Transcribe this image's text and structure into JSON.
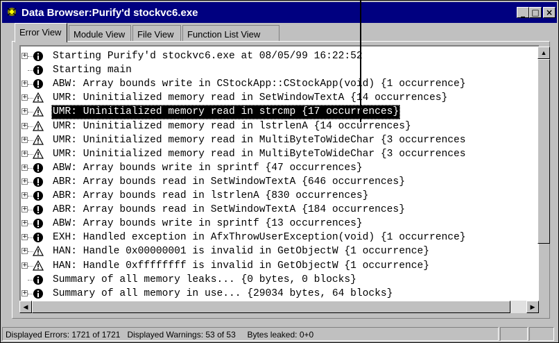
{
  "window": {
    "title": "Data Browser:Purify'd stockvc6.exe",
    "controls": {
      "minimize": "_",
      "maximize": "□",
      "close": "×"
    }
  },
  "tabs": [
    {
      "label": "Error View",
      "active": true
    },
    {
      "label": "Module View",
      "active": false
    },
    {
      "label": "File View",
      "active": false
    },
    {
      "label": "Function List View",
      "active": false
    }
  ],
  "rows": [
    {
      "text": "Starting Purify'd stockvc6.exe at 08/05/99 16:22:52",
      "icon": "info-icon",
      "expandable": true
    },
    {
      "text": "Starting main",
      "icon": "info-icon",
      "expandable": false
    },
    {
      "text": "ABW: Array bounds write in CStockApp::CStockApp(void) {1 occurrence}",
      "icon": "error-icon",
      "expandable": true
    },
    {
      "text": "UMR: Uninitialized memory read in SetWindowTextA {14 occurrences}",
      "icon": "warning-icon",
      "expandable": true
    },
    {
      "text": "UMR: Uninitialized memory read in strcmp {17 occurrences}",
      "icon": "warning-icon",
      "expandable": true,
      "selected": true
    },
    {
      "text": "UMR: Uninitialized memory read in lstrlenA {14 occurrences}",
      "icon": "warning-icon",
      "expandable": true
    },
    {
      "text": "UMR: Uninitialized memory read in MultiByteToWideChar {3 occurrences",
      "icon": "warning-icon",
      "expandable": true
    },
    {
      "text": "UMR: Uninitialized memory read in MultiByteToWideChar {3 occurrences",
      "icon": "warning-icon",
      "expandable": true
    },
    {
      "text": "ABW: Array bounds write in sprintf {47 occurrences}",
      "icon": "error-icon",
      "expandable": true
    },
    {
      "text": "ABR: Array bounds read in SetWindowTextA {646 occurrences}",
      "icon": "error-icon",
      "expandable": true
    },
    {
      "text": "ABR: Array bounds read in lstrlenA {830 occurrences}",
      "icon": "error-icon",
      "expandable": true
    },
    {
      "text": "ABR: Array bounds read in SetWindowTextA {184 occurrences}",
      "icon": "error-icon",
      "expandable": true
    },
    {
      "text": "ABW: Array bounds write in sprintf {13 occurrences}",
      "icon": "error-icon",
      "expandable": true
    },
    {
      "text": "EXH: Handled exception in AfxThrowUserException(void) {1 occurrence}",
      "icon": "info-icon",
      "expandable": true
    },
    {
      "text": "HAN: Handle 0x00000001 is invalid in GetObjectW {1 occurrence}",
      "icon": "warning-icon",
      "expandable": true
    },
    {
      "text": "HAN: Handle 0xffffffff is invalid in GetObjectW {1 occurrence}",
      "icon": "warning-icon",
      "expandable": true
    },
    {
      "text": "Summary of all memory leaks... {0 bytes, 0 blocks}",
      "icon": "info-icon",
      "expandable": false
    },
    {
      "text": "Summary of all memory in use... {29034 bytes, 64 blocks}",
      "icon": "info-icon",
      "expandable": true
    }
  ],
  "status": {
    "errors": "Displayed Errors: 1721 of 1721",
    "warnings": "Displayed Warnings: 53 of 53",
    "leaked": "Bytes leaked: 0+0"
  }
}
